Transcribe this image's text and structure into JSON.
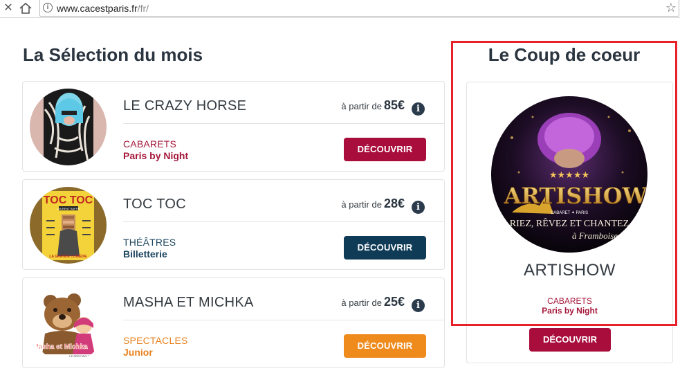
{
  "browser": {
    "url_domain": "www.cacestparis.fr",
    "url_path": "/fr/",
    "close_glyph": "✕",
    "info_glyph": "i",
    "star_glyph": "☆"
  },
  "selection": {
    "heading": "La Sélection du mois",
    "price_prefix": "à partir de",
    "info_glyph": "i",
    "items": [
      {
        "name": "LE CRAZY HORSE",
        "price": "85€",
        "category": "CABARETS",
        "subcategory": "Paris by Night",
        "button": "DÉCOUVRIR",
        "accent": "#a5173a",
        "button_color": "#a90d3c",
        "image_icon": "crazy-horse-dancer-image"
      },
      {
        "name": "TOC TOC",
        "price": "28€",
        "category": "THÉÂTRES",
        "subcategory": "Billetterie",
        "button": "DÉCOUVRIR",
        "accent": "#1e4660",
        "button_color": "#0f3b57",
        "image_icon": "toc-toc-poster-image",
        "poster_title": "TOC TOC",
        "poster_author": "LAURENT BAFFIE",
        "poster_footer": "LA GRANDE COMÉDIE"
      },
      {
        "name": "MASHA ET MICHKA",
        "price": "25€",
        "category": "SPECTACLES",
        "subcategory": "Junior",
        "button": "DÉCOUVRIR",
        "accent": "#e8801e",
        "button_color": "#ef8a1d",
        "image_icon": "masha-michka-image",
        "poster_title": "Masha et Michka",
        "poster_footer": "LE SPECTACLE"
      }
    ]
  },
  "coup_de_coeur": {
    "heading": "Le Coup de coeur",
    "name": "ARTISHOW",
    "category": "CABARETS",
    "subcategory": "Paris by Night",
    "button": "DÉCOUVRIR",
    "accent": "#a5173a",
    "button_color": "#a90d3c",
    "image_icon": "artishow-poster-image",
    "poster_stars": "★★★★★",
    "poster_title": "ARTISHOW",
    "poster_subtitle": "CABARET ✦ PARIS",
    "poster_tagline": "RIEZ, RÊVEZ ET CHANTEZ",
    "poster_signature": "à Framboise",
    "highlight_color": "#e8202a"
  }
}
